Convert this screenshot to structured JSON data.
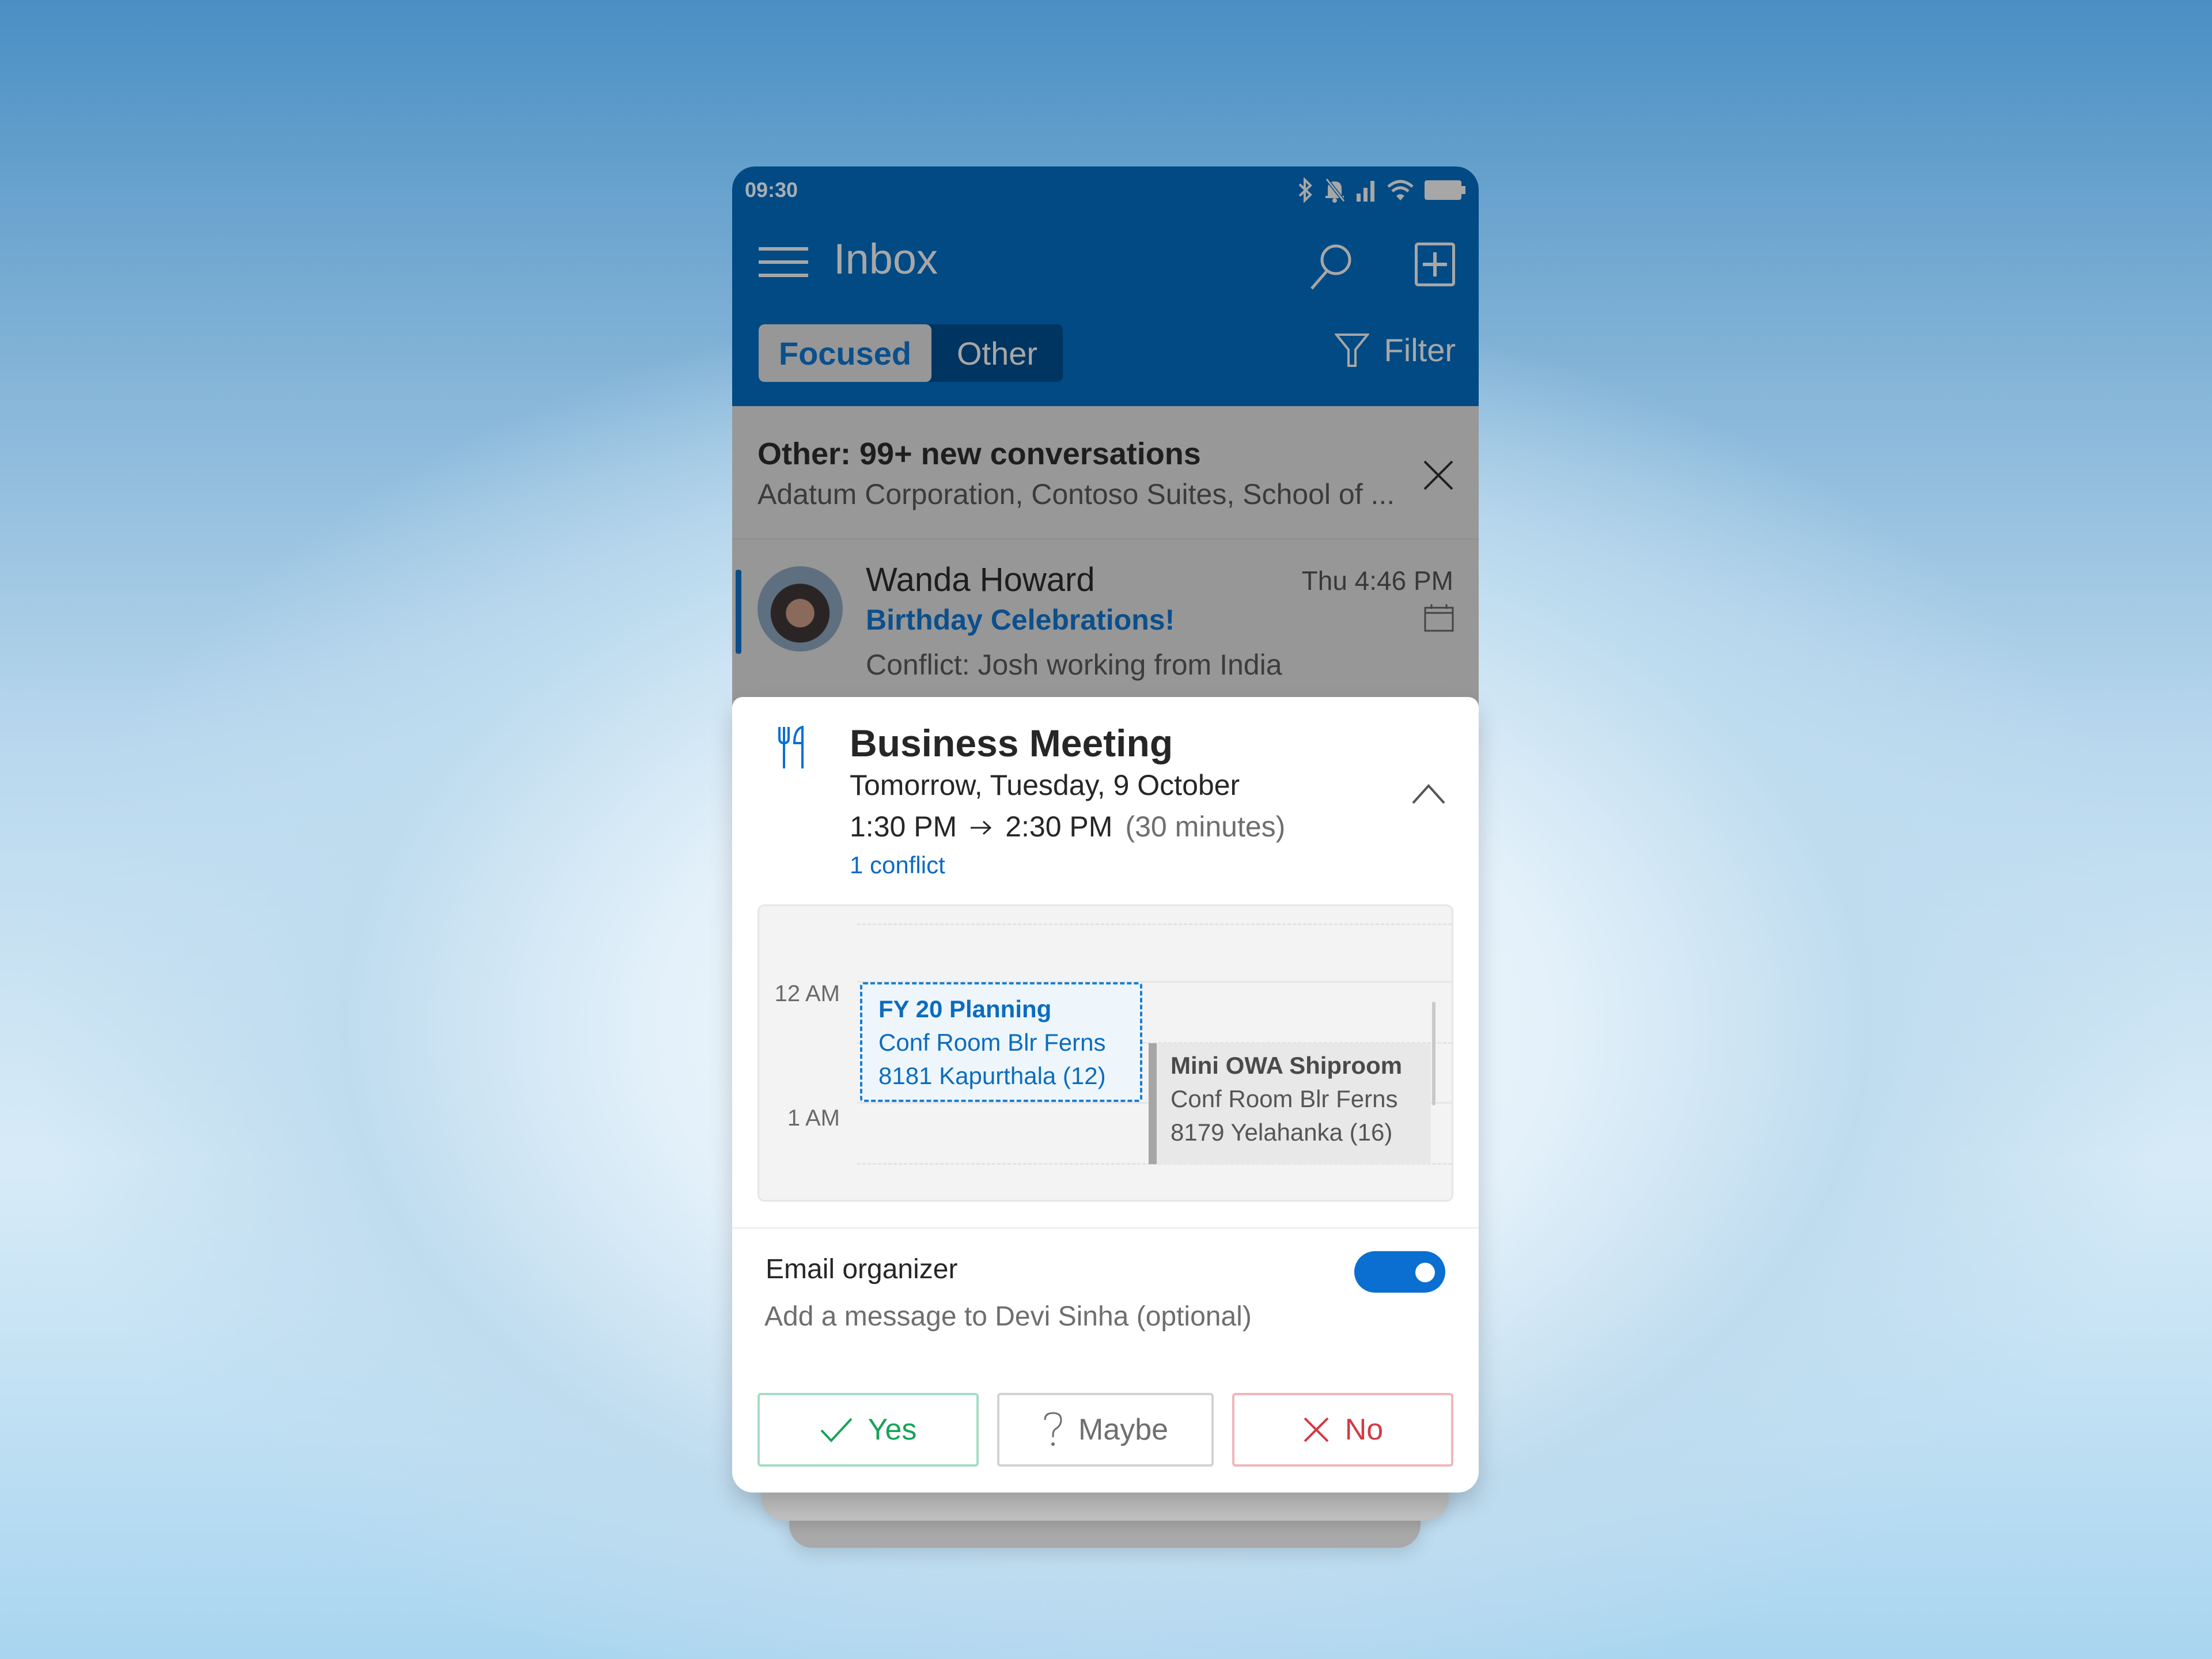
{
  "status_bar": {
    "time": "09:30",
    "icons": [
      "bluetooth-icon",
      "bell-muted-icon",
      "signal-icon",
      "wifi-icon",
      "battery-icon"
    ]
  },
  "header": {
    "title": "Inbox",
    "menu_icon": "hamburger-icon",
    "search_icon": "search-icon",
    "compose_icon": "compose-icon",
    "tabs": [
      {
        "label": "Focused",
        "active": true
      },
      {
        "label": "Other",
        "active": false
      }
    ],
    "filter_label": "Filter"
  },
  "other_banner": {
    "title": "Other: 99+ new conversations",
    "subtitle": "Adatum Corporation, Contoso Suites, School of ..."
  },
  "email": {
    "sender": "Wanda Howard",
    "time": "Thu 4:46 PM",
    "subject": "Birthday Celebrations!",
    "preview": "Conflict: Josh working from India"
  },
  "meeting_card": {
    "icon": "fork-knife-icon",
    "title": "Business Meeting",
    "date": "Tomorrow, Tuesday, 9 October",
    "start": "1:30 PM",
    "end": "2:30 PM",
    "duration": "(30 minutes)",
    "conflict_link": "1 conflict",
    "calendar": {
      "hours": [
        "12 AM",
        "1 AM"
      ],
      "events": [
        {
          "title": "FY 20 Planning",
          "location": "Conf Room Blr Ferns",
          "room": "8181 Kapurthala (12)",
          "style": "proposed"
        },
        {
          "title": "Mini OWA Shiproom",
          "location": "Conf Room Blr Ferns",
          "room": "8179 Yelahanka (16)",
          "style": "existing"
        }
      ]
    },
    "email_organizer_label": "Email organizer",
    "email_organizer_on": true,
    "message_placeholder": "Add a message to Devi Sinha (optional)",
    "buttons": {
      "yes": "Yes",
      "maybe": "Maybe",
      "no": "No"
    }
  },
  "colors": {
    "header_bg": "#014a84",
    "accent_blue": "#0a6fd0",
    "yes_green": "#17a35a",
    "no_red": "#d13a43"
  }
}
